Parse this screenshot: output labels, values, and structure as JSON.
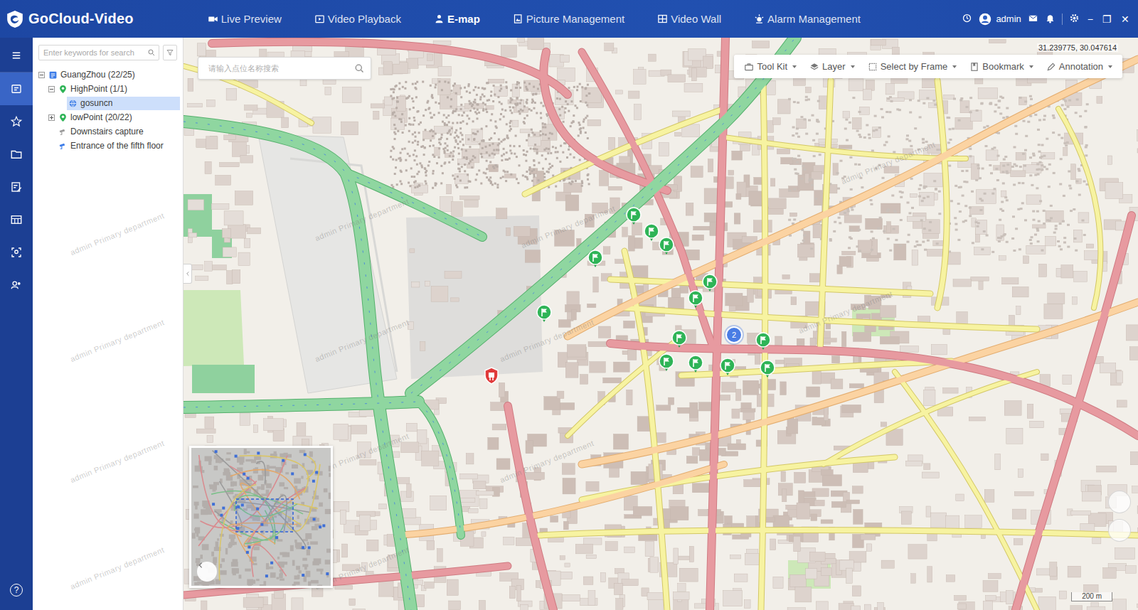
{
  "app": {
    "title": "GoCloud-Video"
  },
  "nav": [
    {
      "label": "Live Preview",
      "selected": false
    },
    {
      "label": "Video Playback",
      "selected": false
    },
    {
      "label": "E-map",
      "selected": true
    },
    {
      "label": "Picture Management",
      "selected": false
    },
    {
      "label": "Video Wall",
      "selected": false
    },
    {
      "label": "Alarm Management",
      "selected": false
    }
  ],
  "user": {
    "name": "admin"
  },
  "window_controls": [
    "−",
    "❐",
    "✕"
  ],
  "rail": {
    "items": [
      {
        "selected": false
      },
      {
        "selected": true
      },
      {
        "selected": false
      },
      {
        "selected": false
      },
      {
        "selected": false
      },
      {
        "selected": false
      },
      {
        "selected": false
      },
      {
        "selected": false
      }
    ],
    "help": "?"
  },
  "tree": {
    "search": {
      "placeholder": "Enter keywords for search"
    },
    "nodes": [
      {
        "label": "GuangZhou (22/25)",
        "depth": 0,
        "kind": "group",
        "expanded": true,
        "selected": false
      },
      {
        "label": "HighPoint (1/1)",
        "depth": 1,
        "kind": "area",
        "expanded": true,
        "selected": false
      },
      {
        "label": "gosuncn",
        "depth": 2,
        "kind": "device",
        "expanded": false,
        "selected": true
      },
      {
        "label": "lowPoint (20/22)",
        "depth": 1,
        "kind": "area",
        "expanded": false,
        "selected": false
      },
      {
        "label": "Downstairs capture",
        "depth": 1,
        "kind": "capture",
        "expanded": false,
        "selected": false
      },
      {
        "label": "Entrance of the fifth floor",
        "depth": 1,
        "kind": "camera",
        "expanded": false,
        "selected": false
      }
    ]
  },
  "map": {
    "search": {
      "placeholder": "请输入点位名称搜索"
    },
    "coordinates": "31.239775, 30.047614",
    "toolbar": [
      "Tool Kit",
      "Layer",
      "Select by Frame",
      "Bookmark",
      "Annotation"
    ],
    "pins": [
      {
        "kind": "camera"
      },
      {
        "kind": "camera"
      },
      {
        "kind": "camera"
      },
      {
        "kind": "camera"
      },
      {
        "kind": "camera"
      },
      {
        "kind": "camera"
      },
      {
        "kind": "camera"
      },
      {
        "kind": "camera"
      },
      {
        "kind": "camera"
      },
      {
        "kind": "camera"
      },
      {
        "kind": "camera"
      },
      {
        "kind": "camera"
      },
      {
        "kind": "camera"
      },
      {
        "kind": "alarm"
      }
    ],
    "cluster": {
      "count": "2"
    },
    "scale": "200 m",
    "watermark": "admin Primary department"
  }
}
